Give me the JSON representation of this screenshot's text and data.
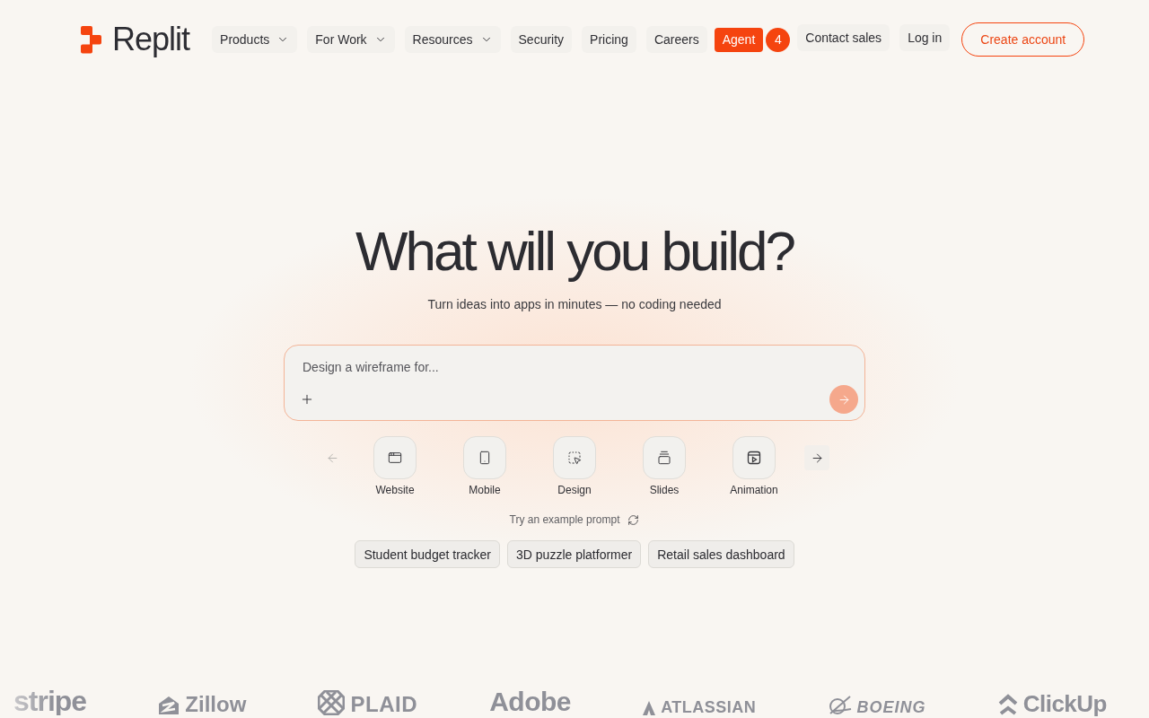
{
  "header": {
    "logo": "Replit",
    "nav": [
      {
        "label": "Products",
        "dropdown": true
      },
      {
        "label": "For Work",
        "dropdown": true
      },
      {
        "label": "Resources",
        "dropdown": true
      },
      {
        "label": "Security",
        "dropdown": false
      },
      {
        "label": "Pricing",
        "dropdown": false
      },
      {
        "label": "Careers",
        "dropdown": false
      }
    ],
    "agent": {
      "label": "Agent",
      "badge": "4"
    },
    "links": [
      "Contact sales",
      "Log in"
    ],
    "cta": "Create account"
  },
  "hero": {
    "title": "What will you build?",
    "subtitle": "Turn ideas into apps in minutes — no coding needed"
  },
  "prompt": {
    "placeholder": "Design a wireframe for...",
    "send_disabled": true
  },
  "categories": {
    "prev_disabled": true,
    "next_disabled": false,
    "items": [
      {
        "kind": "website",
        "label": "Website"
      },
      {
        "kind": "mobile",
        "label": "Mobile"
      },
      {
        "kind": "design",
        "label": "Design"
      },
      {
        "kind": "slides",
        "label": "Slides"
      },
      {
        "kind": "animation",
        "label": "Animation"
      }
    ]
  },
  "examples": {
    "label": "Try an example prompt",
    "chips": [
      "Student budget tracker",
      "3D puzzle platformer",
      "Retail sales dashboard"
    ]
  },
  "logos": [
    {
      "kind": "stripe",
      "text": "stripe"
    },
    {
      "kind": "zillow",
      "text": "Zillow"
    },
    {
      "kind": "plaid",
      "text": "PLAID"
    },
    {
      "kind": "adobe",
      "text": "Adobe"
    },
    {
      "kind": "atlassian",
      "text": "ATLASSIAN"
    },
    {
      "kind": "boeing",
      "text": "BOEING"
    },
    {
      "kind": "clickup",
      "text": "ClickUp"
    }
  ]
}
